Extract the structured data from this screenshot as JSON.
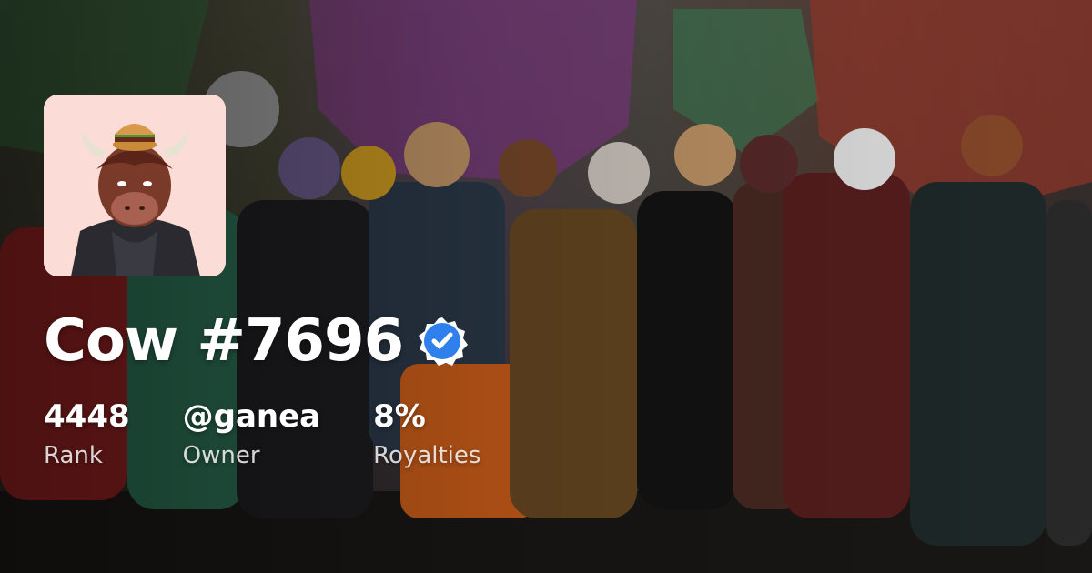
{
  "title": "Cow #7696",
  "verified": true,
  "stats": [
    {
      "value": "4448",
      "label": "Rank"
    },
    {
      "value": "@ganea",
      "label": "Owner"
    },
    {
      "value": "8%",
      "label": "Royalties"
    }
  ],
  "colors": {
    "text": "#ffffff",
    "verified_badge": "#2f80ed",
    "avatar_background": "#fbdcd6"
  },
  "icons": {
    "verified": "verified-check-badge-icon"
  }
}
